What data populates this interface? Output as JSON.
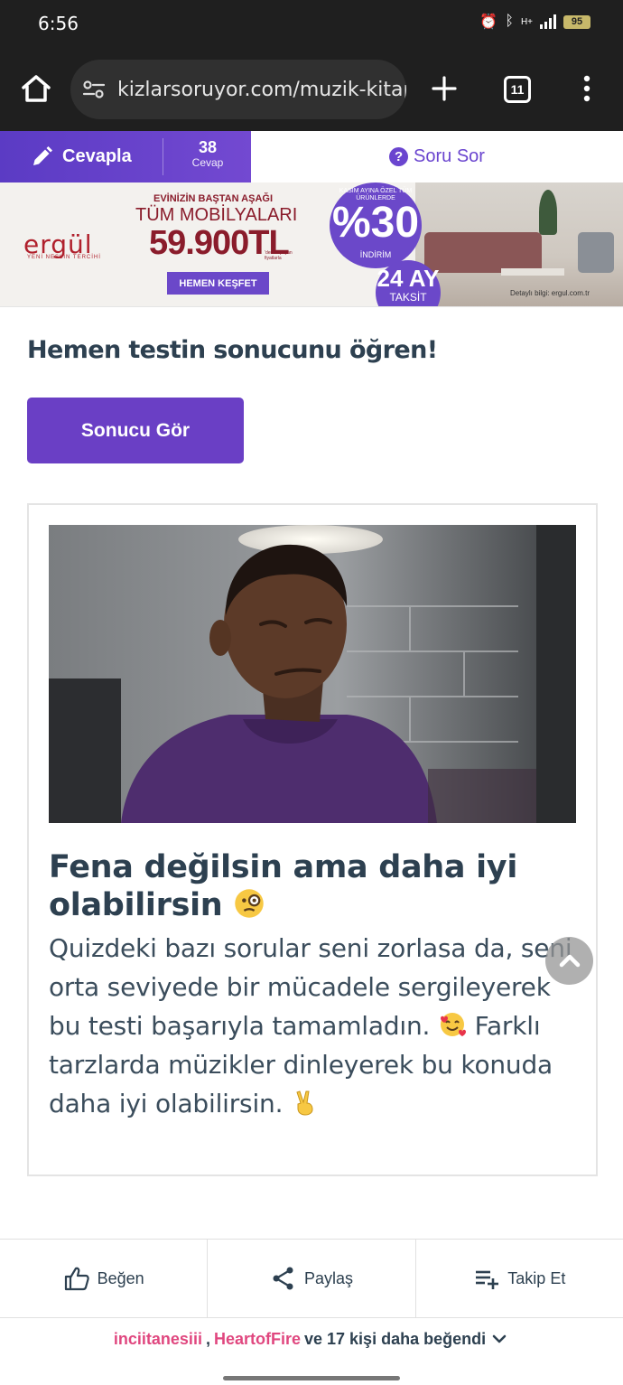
{
  "status_bar": {
    "time": "6:56",
    "battery": "95",
    "network": "H+"
  },
  "browser": {
    "url": "kizlarsoruyor.com/muzik-kitap",
    "tab_count": "11"
  },
  "action_bar": {
    "answer_label": "Cevapla",
    "answer_count": "38",
    "answer_count_label": "Cevap",
    "ask_label": "Soru Sor",
    "accent_color": "#6a45cf"
  },
  "ad": {
    "brand": "ergül",
    "brand_tagline": "YENİ NESLİN TERCİHİ",
    "line1": "EVİNİZİN BAŞTAN AŞAĞI",
    "line2": "TÜM MOBİLYALARI",
    "price": "59.900TL",
    "price_note": "'den başlayan fiyatlarla",
    "cta": "HEMEN KEŞFET",
    "discount_top": "KASIM AYINA ÖZEL TÜM ÜRÜNLERDE",
    "discount_value": "%30",
    "discount_label": "İNDİRİM",
    "installments": "24 AY",
    "installments_label": "TAKSİT",
    "detail": "Detaylı bilgi: ergul.com.tr"
  },
  "main": {
    "heading": "Hemen testin sonucunu öğren!",
    "result_button": "Sonucu Gör",
    "result_title": "Fena değilsin ama daha iyi olabilirsin",
    "result_body_1": "Quizdeki bazı sorular seni zorlasa da, seni orta seviyede bir mücadele sergileyerek bu testi başarıyla tamamladın.",
    "result_body_2": "Farklı tarzlarda müzikler dinleyerek bu konuda daha iyi olabilirsin."
  },
  "bottom_bar": {
    "like": "Beğen",
    "share": "Paylaş",
    "follow": "Takip Et"
  },
  "likes": {
    "user1": "inciitanesiii",
    "separator": ",",
    "user2": "HeartofFire",
    "suffix": "ve 17 kişi daha beğendi"
  }
}
